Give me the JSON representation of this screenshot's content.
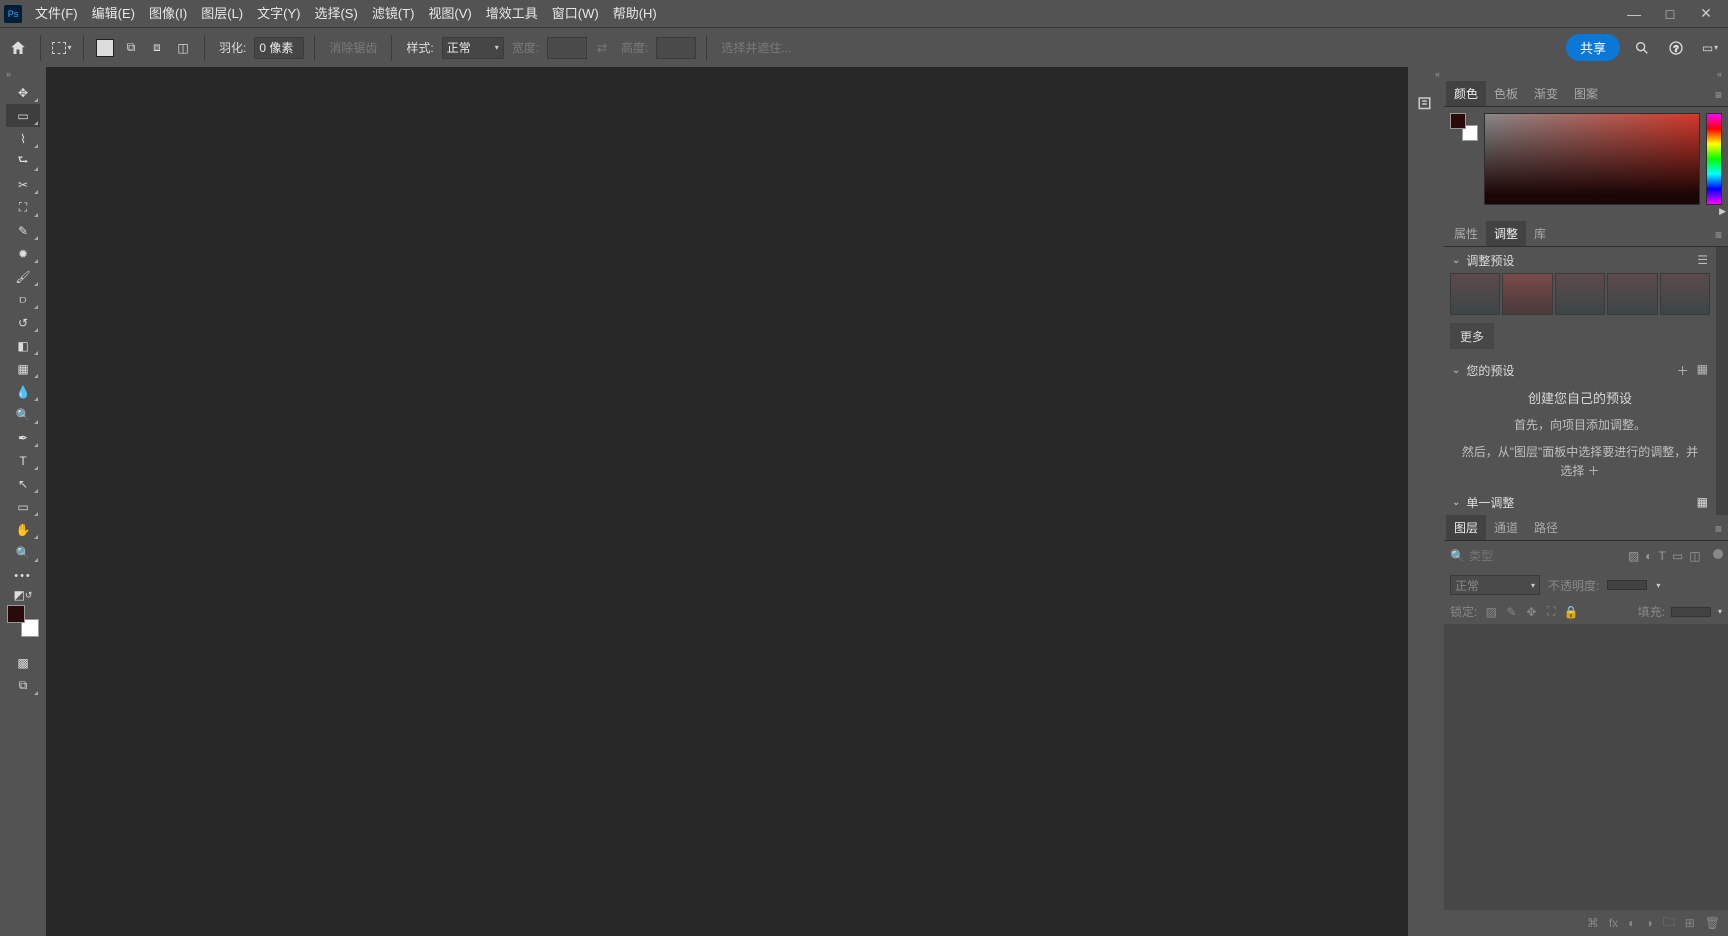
{
  "menu": {
    "items": [
      "文件(F)",
      "编辑(E)",
      "图像(I)",
      "图层(L)",
      "文字(Y)",
      "选择(S)",
      "滤镜(T)",
      "视图(V)",
      "增效工具",
      "窗口(W)",
      "帮助(H)"
    ]
  },
  "win": {
    "min": "—",
    "max": "□",
    "close": "✕"
  },
  "optionsBar": {
    "toolGlyph": "⬚",
    "feather_label": "羽化:",
    "feather_value": "0 像素",
    "antialias": "消除锯齿",
    "style_label": "样式:",
    "style_value": "正常",
    "width_label": "宽度:",
    "height_label": "高度:",
    "mask_label": "选择并遮住...",
    "share": "共享"
  },
  "toolbar": {
    "tools": [
      {
        "name": "move-tool",
        "g": "✥"
      },
      {
        "name": "marquee-tool",
        "g": "▭",
        "sel": true
      },
      {
        "name": "lasso-tool",
        "g": "⌇"
      },
      {
        "name": "object-select-tool",
        "g": "⮑"
      },
      {
        "name": "crop-tool",
        "g": "✂"
      },
      {
        "name": "frame-tool",
        "g": "⛶"
      },
      {
        "name": "eyedropper-tool",
        "g": "✎"
      },
      {
        "name": "healing-brush-tool",
        "g": "✹"
      },
      {
        "name": "brush-tool",
        "g": "🖌"
      },
      {
        "name": "clone-stamp-tool",
        "g": "⫐"
      },
      {
        "name": "history-brush-tool",
        "g": "↺"
      },
      {
        "name": "eraser-tool",
        "g": "◧"
      },
      {
        "name": "gradient-tool",
        "g": "▦"
      },
      {
        "name": "blur-tool",
        "g": "💧"
      },
      {
        "name": "dodge-tool",
        "g": "🔍"
      },
      {
        "name": "pen-tool",
        "g": "✒"
      },
      {
        "name": "type-tool",
        "g": "T"
      },
      {
        "name": "path-select-tool",
        "g": "↖"
      },
      {
        "name": "rectangle-tool",
        "g": "▭"
      },
      {
        "name": "hand-tool",
        "g": "✋"
      },
      {
        "name": "zoom-tool",
        "g": "🔍"
      }
    ],
    "quickmask": "▩",
    "screenmode": "⧉"
  },
  "panels": {
    "colorTabs": [
      "颜色",
      "色板",
      "渐变",
      "图案"
    ],
    "propTabs": [
      "属性",
      "调整",
      "库"
    ],
    "adjustPresets": "调整预设",
    "more": "更多",
    "yourPresets": "您的预设",
    "createPresetTitle": "创建您自己的预设",
    "createPresetLine1": "首先，向项目添加调整。",
    "createPresetLine2": "然后，从\"图层\"面板中选择要进行的调整，并选择 ＋",
    "singleAdjust": "单一调整",
    "layerTabs": [
      "图层",
      "通道",
      "路径"
    ],
    "searchPlaceholder": "类型",
    "blend": "正常",
    "opacity_label": "不透明度:",
    "lock_label": "锁定:",
    "fill_label": "填充:"
  },
  "colors": {
    "fg": "#2a0a0a",
    "bg": "#ffffff"
  }
}
